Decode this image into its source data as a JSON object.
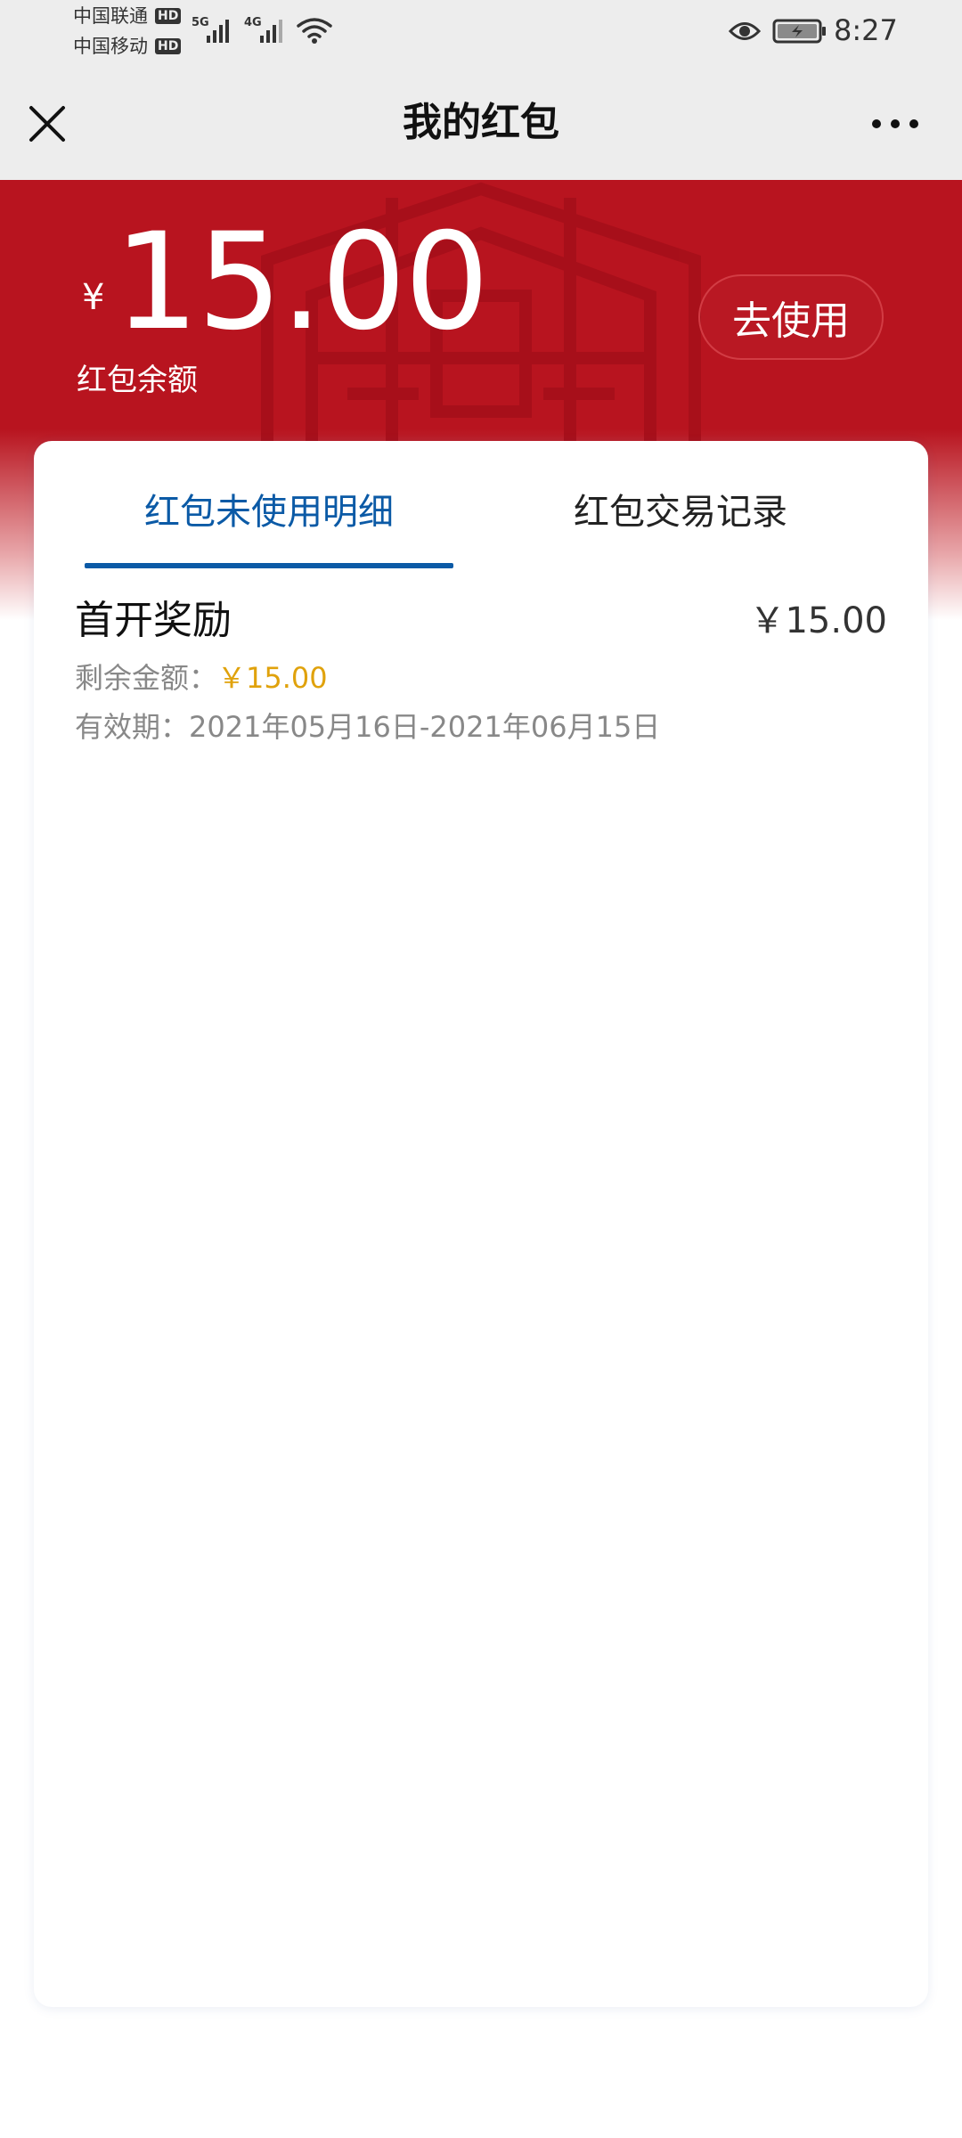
{
  "status_bar": {
    "carrier_1": "中国联通",
    "carrier_1_badge": "HD",
    "carrier_2": "中国移动",
    "carrier_2_badge": "HD",
    "network_1": "5G",
    "network_2": "4G",
    "time": "8:27"
  },
  "nav": {
    "title": "我的红包",
    "close_icon": "close-icon",
    "more_icon": "more-icon"
  },
  "header": {
    "currency": "¥",
    "balance": "15.00",
    "balance_label": "红包余额",
    "use_button": "去使用",
    "background_color": "#b8141f"
  },
  "tabs": [
    {
      "label": "红包未使用明细",
      "active": true
    },
    {
      "label": "红包交易记录",
      "active": false
    }
  ],
  "packets": [
    {
      "name": "首开奖励",
      "amount": "￥15.00",
      "remaining_label": "剩余金额：",
      "remaining_value": "￥15.00",
      "validity": "有效期：2021年05月16日-2021年06月15日"
    }
  ],
  "colors": {
    "active_tab": "#0b5aa6",
    "remaining_value": "#e0a20c"
  }
}
